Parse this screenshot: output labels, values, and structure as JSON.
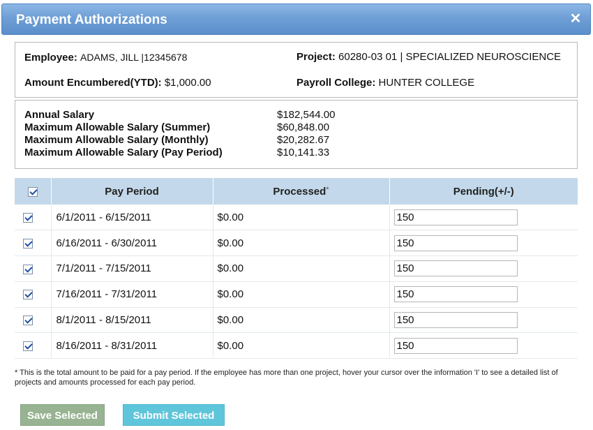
{
  "dialog": {
    "title": "Payment Authorizations",
    "close_glyph": "✕",
    "close_icon": "close-icon"
  },
  "employee": {
    "employee_label": "Employee:",
    "employee_value": "ADAMS, JILL |12345678",
    "amount_label": "Amount Encumbered(YTD):",
    "amount_value": "$1,000.00",
    "project_label": "Project:",
    "project_value": "60280-03 01 | SPECIALIZED NEUROSCIENCE",
    "college_label": "Payroll College:",
    "college_value": "HUNTER COLLEGE"
  },
  "salary": [
    {
      "label": "Annual Salary",
      "value": "$182,544.00"
    },
    {
      "label": "Maximum Allowable Salary (Summer)",
      "value": "$60,848.00"
    },
    {
      "label": "Maximum Allowable Salary (Monthly)",
      "value": "$20,282.67"
    },
    {
      "label": "Maximum Allowable Salary (Pay Period)",
      "value": "$10,141.33"
    }
  ],
  "table": {
    "select_all_checked": true,
    "headers": {
      "pay_period": "Pay Period",
      "processed": "Processed",
      "processed_mark": "*",
      "pending": "Pending(+/-)"
    },
    "rows": [
      {
        "checked": true,
        "period": "6/1/2011 - 6/15/2011",
        "processed": "$0.00",
        "pending": "150"
      },
      {
        "checked": true,
        "period": "6/16/2011 - 6/30/2011",
        "processed": "$0.00",
        "pending": "150"
      },
      {
        "checked": true,
        "period": "7/1/2011 - 7/15/2011",
        "processed": "$0.00",
        "pending": "150"
      },
      {
        "checked": true,
        "period": "7/16/2011 - 7/31/2011",
        "processed": "$0.00",
        "pending": "150"
      },
      {
        "checked": true,
        "period": "8/1/2011 - 8/15/2011",
        "processed": "$0.00",
        "pending": "150"
      },
      {
        "checked": true,
        "period": "8/16/2011 - 8/31/2011",
        "processed": "$0.00",
        "pending": "150"
      }
    ]
  },
  "footnote": "* This is the total amount to be paid for a pay period. If the employee has more than one project, hover your cursor over the information 'I' to see a detailed list of projects and amounts processed for each pay period.",
  "buttons": {
    "save": "Save Selected",
    "submit": "Submit Selected"
  },
  "colors": {
    "title_bar": "#6f9fd6",
    "table_header": "#c3d8ea",
    "save_button": "#97b391",
    "submit_button": "#5fc5da"
  }
}
